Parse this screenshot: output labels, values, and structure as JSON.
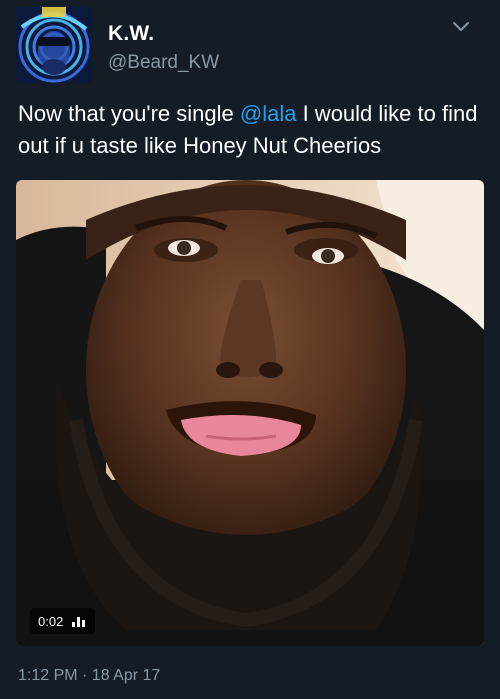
{
  "tweet": {
    "display_name": "K.W.",
    "handle": "@Beard_KW",
    "text_before": "Now that you're single ",
    "mention": "@lala",
    "text_after": " I would like to find out if u taste like Honey Nut Cheerios",
    "timestamp": "1:12 PM · 18 Apr 17"
  },
  "media": {
    "type": "video",
    "duration": "0:02",
    "indicator_icon": "volume-bars-icon"
  },
  "icons": {
    "menu": "chevron-down-icon"
  },
  "colors": {
    "background": "#141d26",
    "accent": "#1da1f2",
    "secondary_text": "#8899a6",
    "primary_text": "#ffffff"
  }
}
